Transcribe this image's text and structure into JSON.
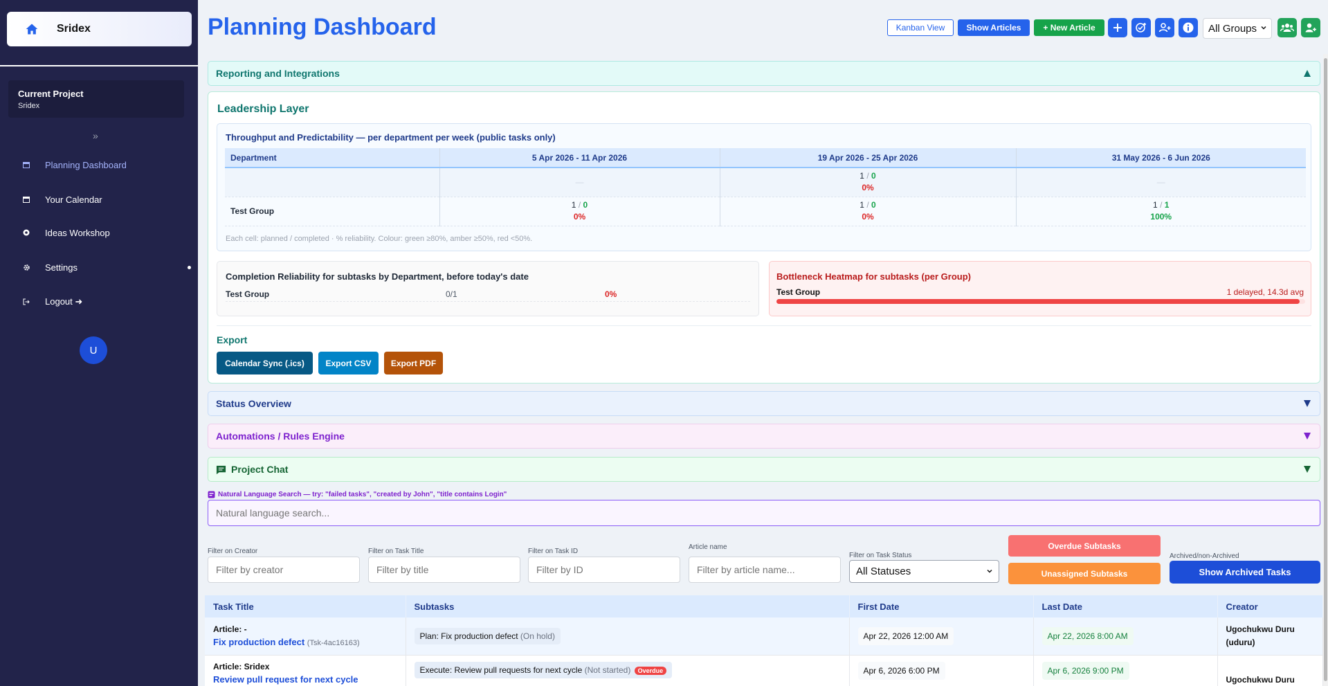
{
  "sidebar": {
    "brand": "Sridex",
    "project_label": "Current Project",
    "project_name": "Sridex",
    "collapse": "»",
    "nav": [
      {
        "label": "Planning Dashboard"
      },
      {
        "label": "Your Calendar"
      },
      {
        "label": "Ideas Workshop"
      },
      {
        "label": "Settings"
      },
      {
        "label": "Logout ➜"
      }
    ],
    "avatar": "U"
  },
  "header": {
    "title": "Planning Dashboard",
    "kanban": "Kanban View",
    "show_articles": "Show Articles",
    "new_article": "+ New Article",
    "group_select": "All Groups"
  },
  "sections": {
    "reporting": "Reporting and Integrations",
    "status": "Status Overview",
    "automations": "Automations / Rules Engine",
    "chat": "Project Chat"
  },
  "leadership": {
    "title": "Leadership Layer",
    "throughput": {
      "title": "Throughput and Predictability — per department per week (public tasks only)",
      "columns": [
        "Department",
        "5 Apr 2026 - 11 Apr 2026",
        "19 Apr 2026 - 25 Apr 2026",
        "31 May 2026 - 6 Jun 2026"
      ],
      "rows": [
        {
          "dept": "",
          "cells": [
            {
              "empty": "—"
            },
            {
              "planned": "1",
              "completed": "0",
              "pct": "0%"
            },
            {
              "empty": "—"
            }
          ]
        },
        {
          "dept": "Test Group",
          "cells": [
            {
              "planned": "1",
              "completed": "0",
              "pct": "0%"
            },
            {
              "planned": "1",
              "completed": "0",
              "pct": "0%"
            },
            {
              "planned": "1",
              "completed": "1",
              "pct": "100%"
            }
          ]
        }
      ],
      "note": "Each cell: planned / completed · % reliability. Colour: green ≥80%, amber ≥50%, red <50%."
    },
    "completion": {
      "title": "Completion Reliability for subtasks by Department, before today's date",
      "group": "Test Group",
      "ratio": "0/1",
      "pct": "0%"
    },
    "bottleneck": {
      "title": "Bottleneck Heatmap for subtasks (per Group)",
      "group": "Test Group",
      "stat": "1 delayed, 14.3d avg",
      "level": 0.99
    },
    "export": {
      "title": "Export",
      "ics": "Calendar Sync (.ics)",
      "csv": "Export CSV",
      "pdf": "Export PDF"
    }
  },
  "search": {
    "hint": "Natural Language Search — try: \"failed tasks\", \"created by John\", \"title contains Login\"",
    "placeholder": "Natural language search..."
  },
  "filters": {
    "creator_label": "Filter on Creator",
    "creator_placeholder": "Filter by creator",
    "title_label": "Filter on Task Title",
    "title_placeholder": "Filter by title",
    "id_label": "Filter on Task ID",
    "id_placeholder": "Filter by ID",
    "article_label": "Article name",
    "article_placeholder": "Filter by article name...",
    "status_label": "Filter on Task Status",
    "status_value": "All Statuses",
    "overdue": "Overdue Subtasks",
    "unassigned": "Unassigned Subtasks",
    "archived_label": "Archived/non-Archived",
    "archived_button": "Show Archived Tasks"
  },
  "tasks": {
    "columns": [
      "Task Title",
      "Subtasks",
      "First Date",
      "Last Date",
      "Creator"
    ],
    "rows": [
      {
        "article": "Article: -",
        "title": "Fix production defect",
        "id": "(Tsk-4ac16163)",
        "subtask": "Plan: Fix production defect",
        "subtask_status": "(On hold)",
        "first": "Apr 22, 2026 12:00 AM",
        "last": "Apr 22, 2026 8:00 AM",
        "creator": "Ugochukwu Duru (uduru)"
      },
      {
        "article": "Article: Sridex",
        "title": "Review pull request for next cycle",
        "subtask": "Execute: Review pull requests for next cycle",
        "subtask_status": "(Not started)",
        "badge": "Overdue",
        "first": "Apr 6, 2026 6:00 PM",
        "last": "Apr 6, 2026 9:00 PM",
        "creator": "Ugochukwu Duru"
      }
    ]
  },
  "colors": {
    "accent": "#2563eb",
    "sidebar": "#22234a",
    "success": "#16a34a",
    "danger": "#dc2626"
  }
}
